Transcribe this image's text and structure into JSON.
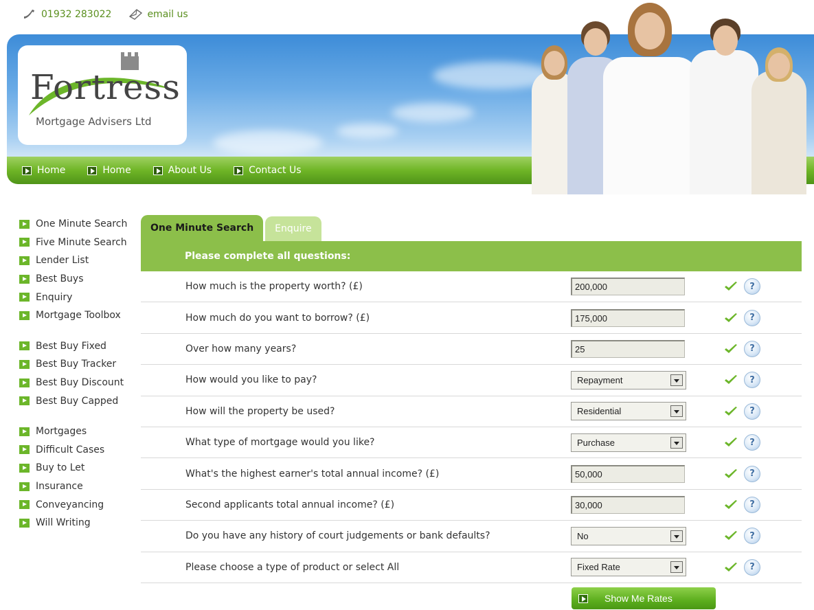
{
  "contact": {
    "phone": "01932 283022",
    "email_label": "email us"
  },
  "logo": {
    "name": "Fortress",
    "subtitle": "Mortgage Advisers Ltd"
  },
  "nav": {
    "items": [
      {
        "label": "Home"
      },
      {
        "label": "Home"
      },
      {
        "label": "About Us"
      },
      {
        "label": "Contact Us"
      }
    ]
  },
  "sidebar": {
    "group1": [
      {
        "label": "One Minute Search"
      },
      {
        "label": "Five Minute Search"
      },
      {
        "label": "Lender List"
      },
      {
        "label": "Best Buys"
      },
      {
        "label": "Enquiry"
      },
      {
        "label": "Mortgage Toolbox"
      }
    ],
    "group2": [
      {
        "label": "Best Buy Fixed"
      },
      {
        "label": "Best Buy Tracker"
      },
      {
        "label": "Best Buy Discount"
      },
      {
        "label": "Best Buy Capped"
      }
    ],
    "group3": [
      {
        "label": "Mortgages"
      },
      {
        "label": "Difficult Cases"
      },
      {
        "label": "Buy to Let"
      },
      {
        "label": "Insurance"
      },
      {
        "label": "Conveyancing"
      },
      {
        "label": "Will Writing"
      }
    ]
  },
  "tabs": [
    {
      "label": "One Minute Search",
      "active": true
    },
    {
      "label": "Enquire",
      "active": false
    }
  ],
  "form": {
    "heading": "Please complete all questions:",
    "help_symbol": "?",
    "rows": [
      {
        "question": "How much is the property worth? (£)",
        "kind": "text",
        "value": "200,000"
      },
      {
        "question": "How much do you want to borrow? (£)",
        "kind": "text",
        "value": "175,000"
      },
      {
        "question": "Over how many years?",
        "kind": "text",
        "value": "25"
      },
      {
        "question": "How would you like to pay?",
        "kind": "select",
        "value": "Repayment"
      },
      {
        "question": "How will the property be used?",
        "kind": "select",
        "value": "Residential"
      },
      {
        "question": "What type of mortgage would you like?",
        "kind": "select",
        "value": "Purchase"
      },
      {
        "question": "What's the highest earner's total annual income? (£)",
        "kind": "text",
        "value": "50,000"
      },
      {
        "question": "Second applicants total annual income? (£)",
        "kind": "text",
        "value": "30,000"
      },
      {
        "question": "Do you have any history of court judgements or bank defaults?",
        "kind": "select",
        "value": "No"
      },
      {
        "question": "Please choose a type of product or select All",
        "kind": "select",
        "value": "Fixed Rate"
      }
    ],
    "submit_label": "Show Me Rates"
  },
  "colors": {
    "accent_green": "#8cbf4a",
    "nav_green": "#6fb526",
    "link_green": "#5a8f1e",
    "sky_blue": "#6aabe6"
  }
}
